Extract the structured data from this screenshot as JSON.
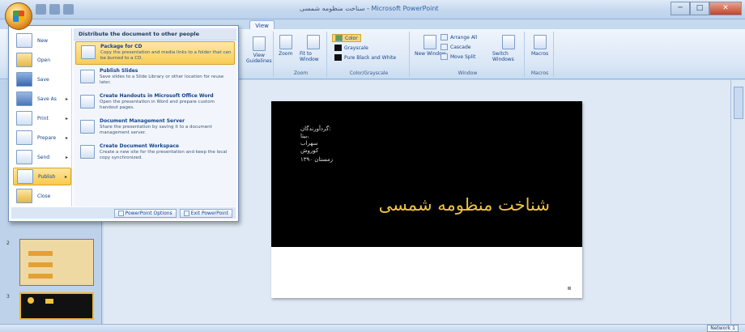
{
  "window": {
    "title": "سناخت منظومه شمسی",
    "title_separator": " - ",
    "app_name": "Microsoft PowerPoint",
    "minimize": "─",
    "maximize": "□",
    "close": "✕"
  },
  "ribbon": {
    "tabs": [
      "View"
    ],
    "groups": [
      {
        "label": "Zoom",
        "buttons": [
          "Zoom",
          "Fit to Window"
        ]
      },
      {
        "label": "Color/Grayscale",
        "buttons": [
          "Color",
          "Grayscale",
          "Pure Black and White"
        ]
      },
      {
        "label": "Window",
        "buttons": [
          "New Window",
          "Arrange All",
          "Cascade",
          "Move Split",
          "Switch Windows"
        ]
      },
      {
        "label": "Macros",
        "buttons": [
          "Macros"
        ]
      }
    ],
    "partial_labels": {
      "view_left": "View",
      "view_left2": "Guidelines"
    }
  },
  "office_menu": {
    "items": [
      {
        "label": "New",
        "icon": "new-doc-icon",
        "arrow": ""
      },
      {
        "label": "Open",
        "icon": "open-folder-icon",
        "arrow": ""
      },
      {
        "label": "Save",
        "icon": "save-disk-icon",
        "arrow": ""
      },
      {
        "label": "Save As",
        "icon": "save-as-icon",
        "arrow": "▸"
      },
      {
        "label": "Print",
        "icon": "printer-icon",
        "arrow": "▸"
      },
      {
        "label": "Prepare",
        "icon": "prepare-icon",
        "arrow": "▸"
      },
      {
        "label": "Send",
        "icon": "send-icon",
        "arrow": "▸"
      },
      {
        "label": "Publish",
        "icon": "publish-icon",
        "arrow": "▸"
      },
      {
        "label": "Close",
        "icon": "close-folder-icon",
        "arrow": ""
      }
    ],
    "active_item": "Publish",
    "submenu_heading": "Distribute the document to other people",
    "submenu": [
      {
        "title": "Package for CD",
        "desc": "Copy the presentation and media links to a folder that can be burned to a CD.",
        "icon": "cd-icon"
      },
      {
        "title": "Publish Slides",
        "desc": "Save slides to a Slide Library or other location for reuse later.",
        "icon": "publish-slides-icon"
      },
      {
        "title": "Create Handouts in Microsoft Office Word",
        "desc": "Open the presentation in Word and prepare custom handout pages.",
        "icon": "word-handouts-icon"
      },
      {
        "title": "Document Management Server",
        "desc": "Share the presentation by saving it to a document management server.",
        "icon": "server-icon"
      },
      {
        "title": "Create Document Workspace",
        "desc": "Create a new site for the presentation and keep the local copy synchronized.",
        "icon": "workspace-icon"
      }
    ],
    "footer": {
      "options": "PowerPoint Options",
      "exit": "Exit PowerPoint"
    }
  },
  "slide": {
    "meta_lines": [
      "گردآورندگان:",
      "بیتا،",
      "سهراب",
      "کوروش"
    ],
    "date": "زمستان ۱۳۹۰",
    "title": "شناخت منظومه شمسی"
  },
  "statusbar": {
    "zoom": "Network 1",
    "text": ""
  },
  "colors": {
    "slide_title": "#f0c340",
    "slide_bg": "#000000",
    "menu_highlight": "#f9c949"
  }
}
